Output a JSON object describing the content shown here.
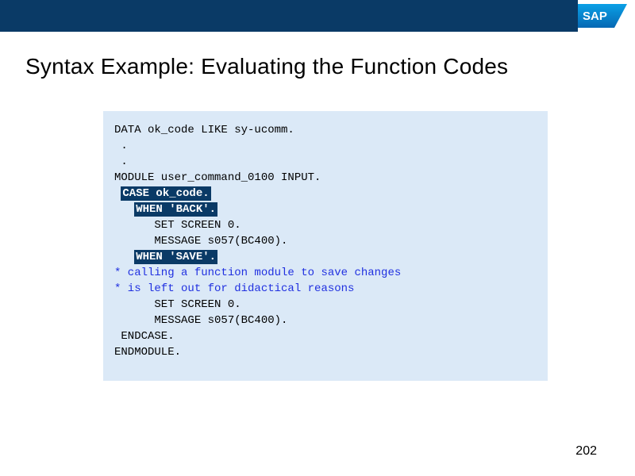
{
  "header": {
    "logo_text": "SAP"
  },
  "title": "Syntax Example: Evaluating the Function Codes",
  "code": {
    "l1": "DATA ok_code LIKE sy-ucomm.",
    "l2": "",
    "l3": "",
    "l4": " .",
    "l5": " .",
    "l6": "",
    "l7": "MODULE user_command_0100 INPUT.",
    "l8_hl": "CASE ok_code.",
    "l9_pre": "   ",
    "l9_hl": "WHEN 'BACK'.",
    "l10": "      SET SCREEN 0.",
    "l11": "      MESSAGE s057(BC400).",
    "l12_pre": "   ",
    "l12_hl": "WHEN 'SAVE'.",
    "l13": "* calling a function module to save changes",
    "l14": "* is left out for didactical reasons",
    "l15": "      SET SCREEN 0.",
    "l16": "      MESSAGE s057(BC400).",
    "l17": " ENDCASE.",
    "l18": "ENDMODULE."
  },
  "page_number": "202"
}
